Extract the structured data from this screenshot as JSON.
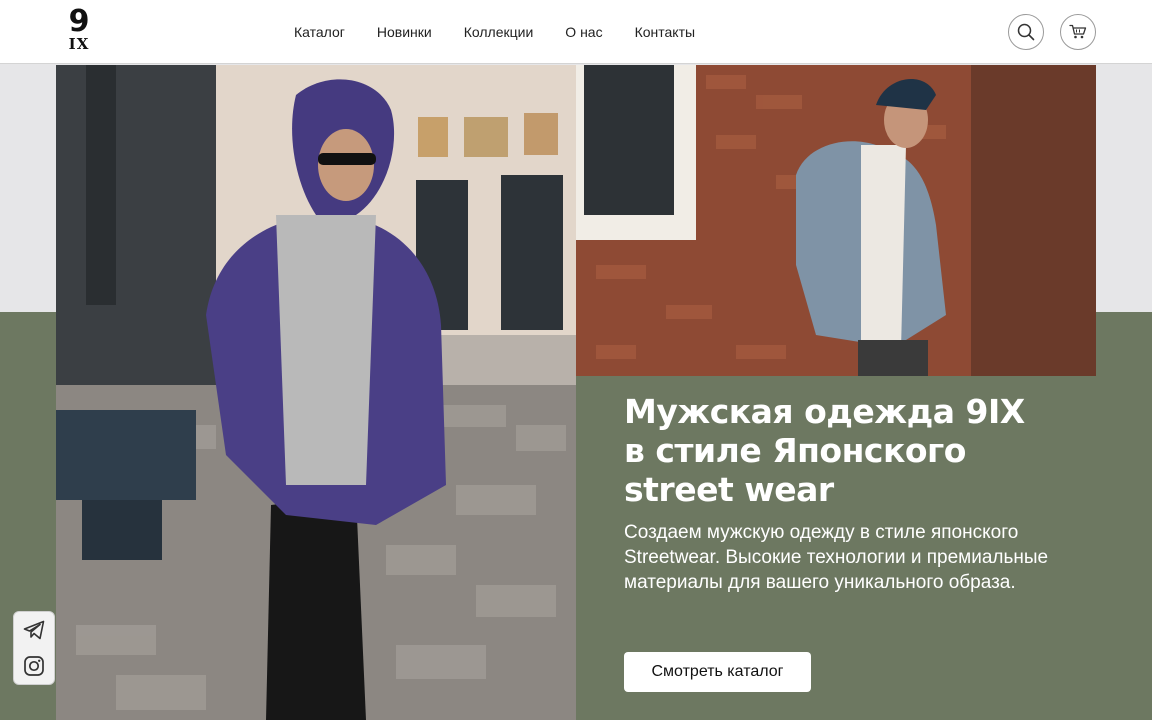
{
  "header": {
    "logo": {
      "top": "9",
      "bottom": "IX"
    },
    "nav": [
      "Каталог",
      "Новинки",
      "Коллекции",
      "О нас",
      "Контакты"
    ],
    "icons": [
      "search-icon",
      "cart-icon"
    ]
  },
  "hero": {
    "title_line1": "Мужская одежда 9IX",
    "title_line2": "в стиле Японского",
    "title_line3": "street wear",
    "text": "Создаем мужскую одежду в стиле японского Streetwear. Высокие технологии и премиальные материалы для вашего уникального образа.",
    "cta_label": "Смотреть каталог"
  },
  "social": {
    "icons": [
      "telegram-icon",
      "instagram-icon"
    ]
  },
  "colors": {
    "accent_green": "#6d7861",
    "header_bg": "#ffffff",
    "page_bg": "#e6e6e8"
  }
}
